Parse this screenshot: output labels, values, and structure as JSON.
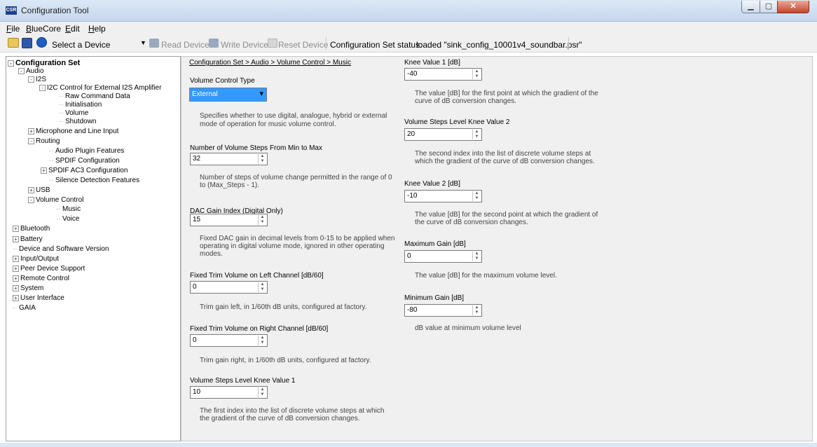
{
  "window": {
    "title": "Configuration Tool",
    "logo_text": "CSR",
    "min_glyph": "▁",
    "max_glyph": "▢",
    "close_glyph": "✕"
  },
  "menu": [
    "File",
    "BlueCore",
    "Edit",
    "Help"
  ],
  "toolbar": {
    "select_device": "Select a Device",
    "read_device": "Read Device",
    "write_device": "Write Device",
    "reset_device": "Reset Device",
    "status_label": "Configuration Set status:",
    "status_value": "loaded \"sink_config_10001v4_soundbar.psr\""
  },
  "tree": [
    {
      "label": "Configuration Set",
      "exp": "-"
    },
    {
      "label": "Audio",
      "exp": "-"
    },
    {
      "label": "I2S",
      "exp": "-"
    },
    {
      "label": "I2C Control for External I2S Amplifier",
      "exp": "-"
    },
    {
      "label": "Raw Command Data",
      "exp": ""
    },
    {
      "label": "Initialisation",
      "exp": ""
    },
    {
      "label": "Volume",
      "exp": ""
    },
    {
      "label": "Shutdown",
      "exp": ""
    },
    {
      "label": "Microphone and Line Input",
      "exp": "+"
    },
    {
      "label": "Routing",
      "exp": "-"
    },
    {
      "label": "Audio Plugin Features",
      "exp": ""
    },
    {
      "label": "SPDIF Configuration",
      "exp": ""
    },
    {
      "label": "SPDIF AC3 Configuration",
      "exp": "+"
    },
    {
      "label": "Silence Detection Features",
      "exp": ""
    },
    {
      "label": "USB",
      "exp": "+"
    },
    {
      "label": "Volume Control",
      "exp": "-"
    },
    {
      "label": "Music",
      "exp": ""
    },
    {
      "label": "Voice",
      "exp": ""
    },
    {
      "label": "Bluetooth",
      "exp": "+"
    },
    {
      "label": "Battery",
      "exp": "+"
    },
    {
      "label": "Device and Software Version",
      "exp": ""
    },
    {
      "label": "Input/Output",
      "exp": "+"
    },
    {
      "label": "Peer Device Support",
      "exp": "+"
    },
    {
      "label": "Remote Control",
      "exp": "+"
    },
    {
      "label": "System",
      "exp": "+"
    },
    {
      "label": "User Interface",
      "exp": "+"
    },
    {
      "label": "GAIA",
      "exp": ""
    }
  ],
  "breadcrumb": "Configuration Set > Audio > Volume Control > Music",
  "volume_control_type": {
    "label": "Volume Control Type",
    "value": "External",
    "desc1": "Specifies whether to use digital, analogue, hybrid or external",
    "desc2": "mode of operation for music volume control."
  },
  "fields": [
    {
      "label": "Number of Volume Steps From Min to Max",
      "value": "32",
      "desc1": "Number of steps of volume change permitted in the range of 0",
      "desc2": "to (Max_Steps - 1).",
      "desc3": ""
    },
    {
      "label": "DAC Gain Index (Digital Only)",
      "value": "15",
      "desc1": "Fixed DAC gain in decimal levels from 0-15 to be applied when",
      "desc2": "operating in digital volume mode, ignored in other operating",
      "desc3": "modes."
    },
    {
      "label": "Fixed Trim Volume on Left Channel [dB/60]",
      "value": "0",
      "desc1": "Trim gain left, in 1/60th dB units, configured at factory.",
      "desc2": "",
      "desc3": ""
    },
    {
      "label": "Fixed Trim Volume on Right Channel [dB/60]",
      "value": "0",
      "desc1": "Trim gain right, in 1/60th dB units, configured at factory.",
      "desc2": "",
      "desc3": ""
    },
    {
      "label": "Volume Steps Level Knee Value 1",
      "value": "10",
      "desc1": "The first index into the list of discrete volume steps at which",
      "desc2": "the gradient of the curve of dB conversion changes.",
      "desc3": ""
    },
    {
      "label": "Knee Value 1  [dB]",
      "value": "-40",
      "desc1": "The value [dB] for the first point at which the gradient of the",
      "desc2": "curve of dB conversion changes.",
      "desc3": ""
    },
    {
      "label": "Volume Steps Level Knee Value 2",
      "value": "20",
      "desc1": "The second index into the list of discrete volume steps at",
      "desc2": "which the gradient of the curve of dB conversion changes.",
      "desc3": ""
    },
    {
      "label": "Knee Value 2 [dB]",
      "value": "-10",
      "desc1": "The value [dB] for the second point at which the gradient of",
      "desc2": "the curve of dB conversion changes.",
      "desc3": ""
    },
    {
      "label": "Maximum Gain [dB]",
      "value": "0",
      "desc1": "The value [dB] for the maximum volume level.",
      "desc2": "",
      "desc3": ""
    },
    {
      "label": "Minimum Gain [dB]",
      "value": "-80",
      "desc1": "dB value at minimum volume level",
      "desc2": "",
      "desc3": ""
    }
  ],
  "colors": {
    "selection": "#3399ff",
    "panel_bg": "#f0f0f0"
  }
}
